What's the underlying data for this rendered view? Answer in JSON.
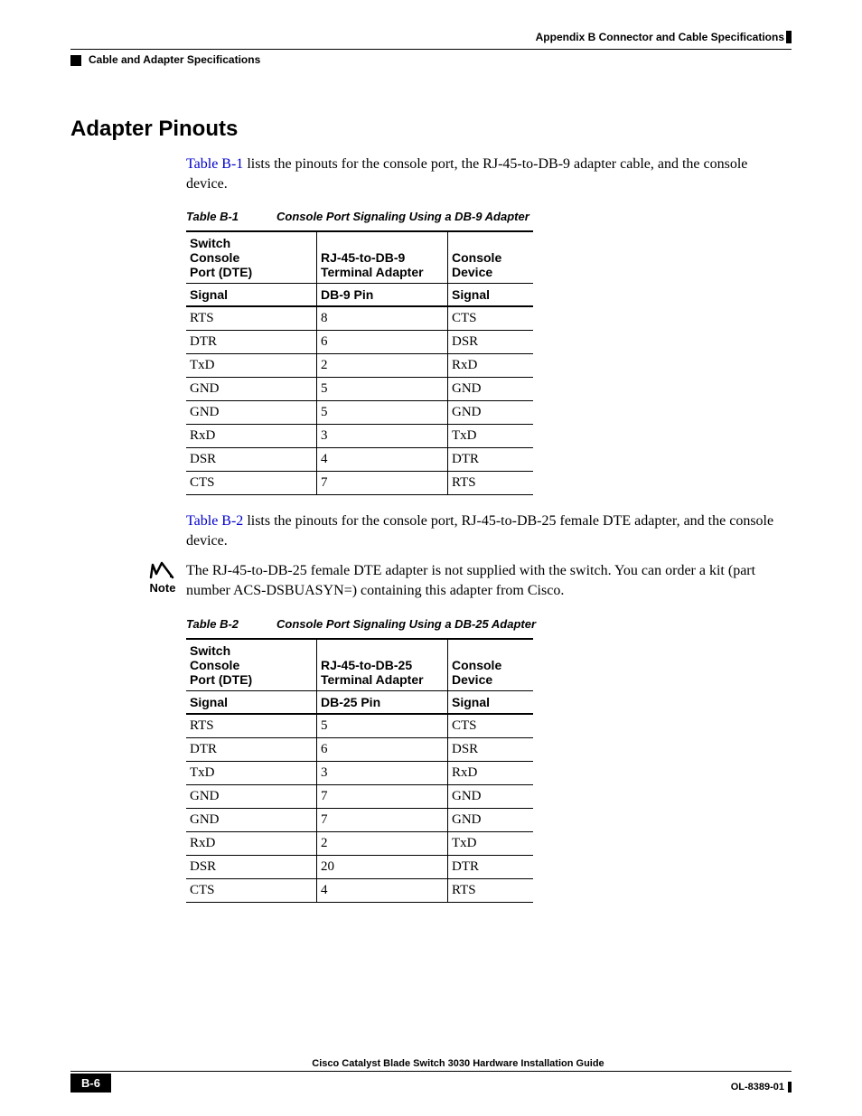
{
  "header": {
    "appendix": "Appendix B      Connector and Cable Specifications",
    "section": "Cable and Adapter Specifications"
  },
  "title": "Adapter Pinouts",
  "intro1_link": "Table B-1",
  "intro1_rest": " lists the pinouts for the console port, the RJ-45-to-DB-9 adapter cable, and the console device.",
  "table1": {
    "caption_num": "Table B-1",
    "caption_title": "Console Port Signaling Using a DB-9 Adapter",
    "h1a": "Switch",
    "h1b": "Console",
    "h1c": "Port (DTE)",
    "h2a": "RJ-45-to-DB-9",
    "h2b": "Terminal Adapter",
    "h3a": "Console",
    "h3b": "Device",
    "sub1": "Signal",
    "sub2": "DB-9 Pin",
    "sub3": "Signal",
    "rows": [
      {
        "a": "RTS",
        "b": "8",
        "c": "CTS"
      },
      {
        "a": "DTR",
        "b": "6",
        "c": "DSR"
      },
      {
        "a": "TxD",
        "b": "2",
        "c": "RxD"
      },
      {
        "a": "GND",
        "b": "5",
        "c": "GND"
      },
      {
        "a": "GND",
        "b": "5",
        "c": "GND"
      },
      {
        "a": "RxD",
        "b": "3",
        "c": "TxD"
      },
      {
        "a": "DSR",
        "b": "4",
        "c": "DTR"
      },
      {
        "a": "CTS",
        "b": "7",
        "c": "RTS"
      }
    ]
  },
  "intro2_link": "Table B-2",
  "intro2_rest": " lists the pinouts for the console port, RJ-45-to-DB-25 female DTE adapter, and the console device.",
  "note_label": "Note",
  "note_text": "The RJ-45-to-DB-25 female DTE adapter is not supplied with the switch. You can order a kit (part number ACS-DSBUASYN=) containing this adapter from Cisco.",
  "table2": {
    "caption_num": "Table B-2",
    "caption_title": "Console Port Signaling Using a DB-25 Adapter",
    "h1a": "Switch",
    "h1b": "Console",
    "h1c": "Port (DTE)",
    "h2a": "RJ-45-to-DB-25",
    "h2b": "Terminal Adapter",
    "h3a": "Console",
    "h3b": "Device",
    "sub1": "Signal",
    "sub2": "DB-25 Pin",
    "sub3": "Signal",
    "rows": [
      {
        "a": "RTS",
        "b": "5",
        "c": "CTS"
      },
      {
        "a": "DTR",
        "b": "6",
        "c": "DSR"
      },
      {
        "a": "TxD",
        "b": "3",
        "c": "RxD"
      },
      {
        "a": "GND",
        "b": "7",
        "c": "GND"
      },
      {
        "a": "GND",
        "b": "7",
        "c": "GND"
      },
      {
        "a": "RxD",
        "b": "2",
        "c": "TxD"
      },
      {
        "a": "DSR",
        "b": "20",
        "c": "DTR"
      },
      {
        "a": "CTS",
        "b": "4",
        "c": "RTS"
      }
    ]
  },
  "footer": {
    "book": "Cisco Catalyst Blade Switch 3030 Hardware Installation Guide",
    "page": "B-6",
    "docid": "OL-8389-01"
  }
}
